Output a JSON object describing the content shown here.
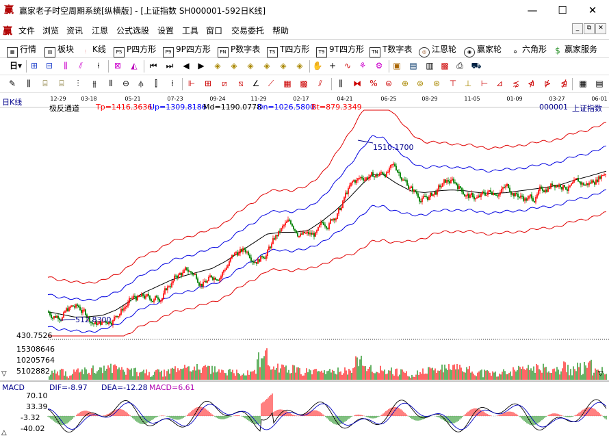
{
  "window": {
    "title": "赢家老子时空周期系统[纵横版] - [上证指数  SH000001-592日K线]",
    "minimize": "—",
    "maximize": "☐",
    "close": "✕"
  },
  "menu": {
    "items": [
      "文件",
      "浏览",
      "资讯",
      "江恩",
      "公式选股",
      "设置",
      "工具",
      "窗口",
      "交易委托",
      "帮助"
    ],
    "mdi": [
      "_",
      "⧉",
      "✕"
    ]
  },
  "nav": {
    "items": [
      {
        "label": "行情",
        "icon": "grid-icon"
      },
      {
        "label": "板块",
        "icon": "blocks-icon"
      },
      {
        "label": "K线",
        "icon": "candle-icon"
      },
      {
        "label": "P四方形",
        "icon": "ps-icon",
        "badge": "PS"
      },
      {
        "label": "9P四方形",
        "icon": "p9-icon",
        "badge": "P9"
      },
      {
        "label": "P数字表",
        "icon": "pn-icon",
        "badge": "PN"
      },
      {
        "label": "T四方形",
        "icon": "ts-icon",
        "badge": "TS"
      },
      {
        "label": "9T四方形",
        "icon": "t9-icon",
        "badge": "T9"
      },
      {
        "label": "T数字表",
        "icon": "tn-icon",
        "badge": "TN"
      },
      {
        "label": "江恩轮",
        "icon": "gann-wheel-icon"
      },
      {
        "label": "赢家轮",
        "icon": "winner-wheel-icon"
      },
      {
        "label": "六角形",
        "icon": "hexagon-icon"
      },
      {
        "label": "赢家服务",
        "icon": "dollar-icon"
      }
    ]
  },
  "toolbar1": {
    "period": "日"
  },
  "chart": {
    "period_label": "日K线",
    "indicator_name": "极反通道",
    "indicator_values": [
      {
        "text": "Tp=1416.3636",
        "color": "#ff0000"
      },
      {
        "text": "Up=1309.8186",
        "color": "#0000ff"
      },
      {
        "text": "Md=1190.0778",
        "color": "#000000"
      },
      {
        "text": "Dn=1026.5800",
        "color": "#0000ff"
      },
      {
        "text": "Bt=879.3349",
        "color": "#ff0000"
      }
    ],
    "symbol": "000001",
    "symbol_name": "上证指数",
    "dates": [
      "12-29",
      "03-18",
      "05-21",
      "07-23",
      "09-24",
      "11-29",
      "02-17",
      "04-21",
      "06-25",
      "08-29",
      "11-05",
      "01-09",
      "03-27",
      "06-01"
    ],
    "high_label": "1510.1700",
    "low_label": "512.8300",
    "price_axis_bottom": "430.7526",
    "volume_axis": [
      "15308646",
      "10205764",
      "5102882"
    ],
    "macd": {
      "name": "MACD",
      "dif": "DIF=-8.97",
      "dea": "DEA=-12.28",
      "macd": "MACD=6.61",
      "axis": [
        "70.10",
        "33.39",
        "-3.32",
        "-40.02"
      ]
    }
  },
  "colors": {
    "up": "#ff0000",
    "down": "#008000",
    "band_outer": "#e00000",
    "band_inner": "#0000e0",
    "mid": "#000000",
    "brand": "#b00000"
  }
}
